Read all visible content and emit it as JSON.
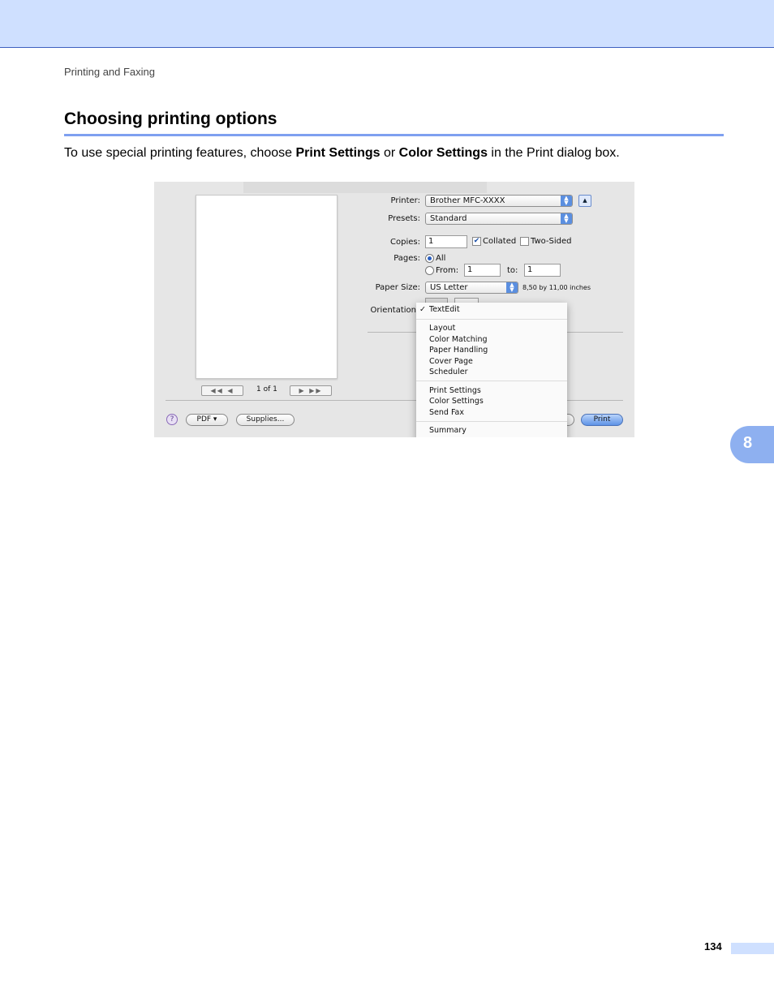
{
  "header": {
    "running_head": "Printing and Faxing"
  },
  "section": {
    "title": "Choosing printing options",
    "intro_prefix": "To use special printing features, choose ",
    "intro_bold1": "Print Settings",
    "intro_mid": " or ",
    "intro_bold2": "Color Settings",
    "intro_suffix": " in the Print dialog box."
  },
  "dialog": {
    "printer_label": "Printer:",
    "printer_value": "Brother MFC-XXXX",
    "presets_label": "Presets:",
    "presets_value": "Standard",
    "copies_label": "Copies:",
    "copies_value": "1",
    "collated_label": "Collated",
    "collated_checked": true,
    "two_sided_label": "Two-Sided",
    "pages_label": "Pages:",
    "pages_all": "All",
    "pages_from": "From:",
    "from_value": "1",
    "pages_to": "to:",
    "to_value": "1",
    "paper_size_label": "Paper Size:",
    "paper_size_value": "US Letter",
    "paper_dimensions": "8,50 by 11,00 inches",
    "orientation_label": "Orientation",
    "page_counter": "1 of 1",
    "nav_first_prev": "◀◀  ◀",
    "nav_next_last": "▶  ▶▶",
    "help": "?",
    "pdf_button": "PDF ▾",
    "supplies_button": "Supplies...",
    "print_button": "Print",
    "disclosure_icon": "▲"
  },
  "menu": {
    "checkmark": "✓",
    "checked_item": "TextEdit",
    "group1": [
      "Layout",
      "Color Matching",
      "Paper Handling",
      "Cover Page",
      "Scheduler"
    ],
    "group2": [
      "Print Settings",
      "Color Settings",
      "Send Fax"
    ],
    "group3": [
      "Summary"
    ]
  },
  "footer": {
    "chapter": "8",
    "page_number": "134"
  }
}
